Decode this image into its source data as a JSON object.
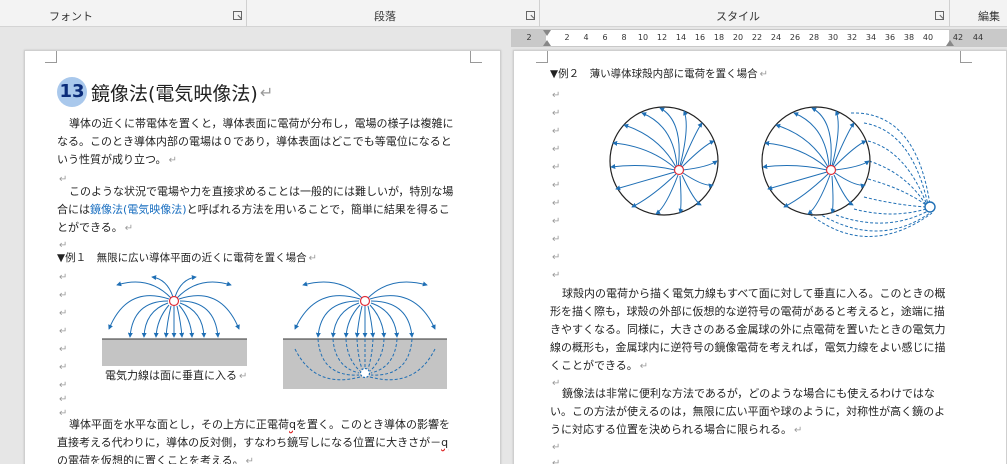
{
  "ribbon": {
    "groups": [
      {
        "label": "フォント"
      },
      {
        "label": "段落"
      },
      {
        "label": "スタイル"
      },
      {
        "label": "編集"
      }
    ]
  },
  "ruler": {
    "ticks": [
      "2",
      "2",
      "4",
      "6",
      "8",
      "10",
      "12",
      "14",
      "16",
      "18",
      "20",
      "22",
      "24",
      "26",
      "28",
      "30",
      "32",
      "34",
      "36",
      "38",
      "40",
      "42",
      "44"
    ]
  },
  "left_page": {
    "heading_number": "13",
    "heading_text": "鏡像法(電気映像法)",
    "heading_mark": "↵",
    "para1": [
      "導体の近くに帯電体を置くと，導体表面に電荷が分布し，電場の様子は複雑に",
      "なる。このとき導体内部の電場は０であり，導体表面はどこでも等電位になると",
      "いう性質が成り立つ。"
    ],
    "para2_line1": "このような状況で電場や力を直接求めることは一般的には難しいが，特別な場",
    "para2_line2_pre": "合には",
    "para2_link": "鏡像法(電気映像法)",
    "para2_line2_post": "と呼ばれる方法を用いることで，簡単に結果を得るこ",
    "para2_line3": "とができる。",
    "example1": "▼例１　無限に広い導体平面の近くに電荷を置く場合",
    "caption": "電気力線は面に垂直に入る",
    "para3_line1_pre": "導体平面を水平な面とし，その上方に正電荷",
    "para3_q": "q",
    "para3_line1_post": "を置く。このとき導体の影響を",
    "para3_line2_pre": "直接考える代わりに，導体の反対側，すなわち鏡写しになる位置に大きさが－",
    "para3_line2_q": "q",
    "para3_line3": "の電荷を仮想的に置くことを考える。",
    "para_mark": "↵"
  },
  "right_page": {
    "example2": "▼例２　薄い導体球殻内部に電荷を置く場合",
    "para1": [
      "球殻内の電荷から描く電気力線もすべて面に対して垂直に入る。このときの概",
      "形を描く際も，球殻の外部に仮想的な逆符号の電荷があると考えると，途端に描",
      "きやすくなる。同様に，大きさのある金属球の外に点電荷を置いたときの電気力",
      "線の概形も，金属球内に逆符号の鏡像電荷を考えれば，電気力線をよい感じに描",
      "くことができる。"
    ],
    "para2": [
      "鏡像法は非常に便利な方法であるが，どのような場合にも使えるわけではな",
      "い。この方法が使えるのは，無限に広い平面や球のように，対称性が高く鏡のよ",
      "うに対応する位置を決められる場合に限られる。"
    ],
    "para_mark": "↵"
  },
  "colors": {
    "field_line": "#1f6fb5",
    "charge_ring": "#e0303a",
    "conductor": "#c4c4c4",
    "heading_badge": "#a9c8ec"
  }
}
